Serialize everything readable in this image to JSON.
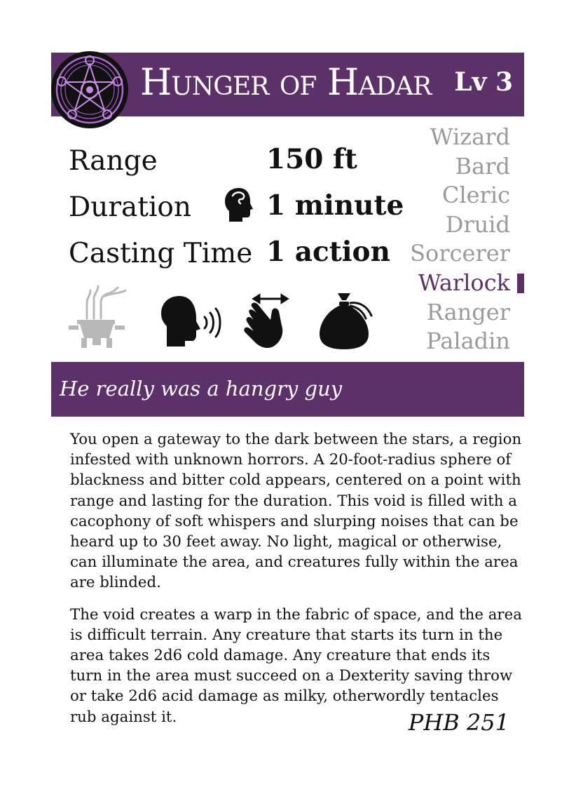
{
  "colors": {
    "accent": "#5c3068",
    "muted_class": "#9a9a9a",
    "icon_gray": "#b8b8b8"
  },
  "spell": {
    "name": "Hunger of Hadar",
    "level": "Lv 3"
  },
  "stats": [
    {
      "label": "Range",
      "value": "150 ft"
    },
    {
      "label": "Duration",
      "value": "1 minute",
      "icon": "concentration-head-icon"
    },
    {
      "label": "Casting Time",
      "value": "1 action"
    }
  ],
  "classes": [
    {
      "name": "Wizard",
      "active": false
    },
    {
      "name": "Bard",
      "active": false
    },
    {
      "name": "Cleric",
      "active": false
    },
    {
      "name": "Druid",
      "active": false
    },
    {
      "name": "Sorcerer",
      "active": false
    },
    {
      "name": "Warlock",
      "active": true
    },
    {
      "name": "Ranger",
      "active": false
    },
    {
      "name": "Paladin",
      "active": false
    }
  ],
  "components": [
    {
      "icon": "ritual-brazier-icon",
      "active": false
    },
    {
      "icon": "verbal-speaking-head-icon",
      "active": true
    },
    {
      "icon": "somatic-hand-icon",
      "active": true
    },
    {
      "icon": "material-pouch-icon",
      "active": true
    }
  ],
  "emblem_icon": "magic-circle-emblem-icon",
  "flavor": "He really was a hangry guy",
  "description": [
    "You open a gateway to the dark between the stars, a region infested with unknown horrors. A 20-foot-radius sphere of blackness and bitter cold appears, centered on a point with range and lasting for the duration. This void is filled with a cacophony of soft whispers and slurping noises that can be heard up to 30 feet away. No light, magical or otherwise, can illuminate the area, and creatures fully within the area are blinded.",
    "The void creates a warp in the fabric of space, and the area is difficult terrain. Any creature that starts its turn in the area takes 2d6 cold damage. Any creature that ends its turn in the area must succeed on a Dexterity saving throw or take 2d6 acid damage as milky, otherwordly tentacles rub against it."
  ],
  "source": "PHB 251"
}
